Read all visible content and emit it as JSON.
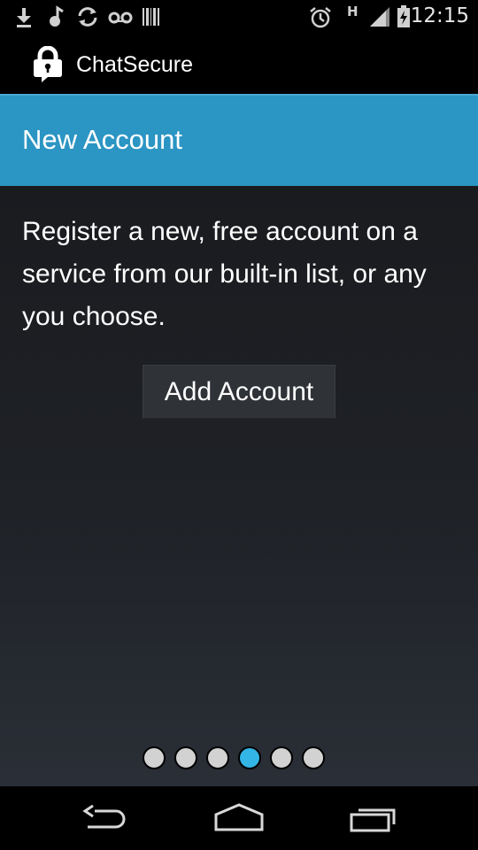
{
  "status_bar": {
    "time": "12:15",
    "network_type": "H",
    "icons": [
      "download-icon",
      "media-icon",
      "sync-icon",
      "voicemail-icon",
      "barcode-icon",
      "alarm-icon",
      "signal-icon",
      "battery-charging-icon"
    ]
  },
  "action_bar": {
    "app_title": "ChatSecure",
    "logo_icon": "chat-lock-icon"
  },
  "page": {
    "title": "New Account",
    "description": "Register a new, free account on a service from our built-in list, or any you choose.",
    "add_button_label": "Add Account"
  },
  "pager": {
    "total": 6,
    "active_index": 3
  },
  "nav_bar": {
    "buttons": [
      "back-icon",
      "home-icon",
      "recent-apps-icon"
    ]
  },
  "colors": {
    "accent": "#2b95c3",
    "active_dot": "#33b5e5",
    "inactive_dot": "#d2d2d2"
  }
}
